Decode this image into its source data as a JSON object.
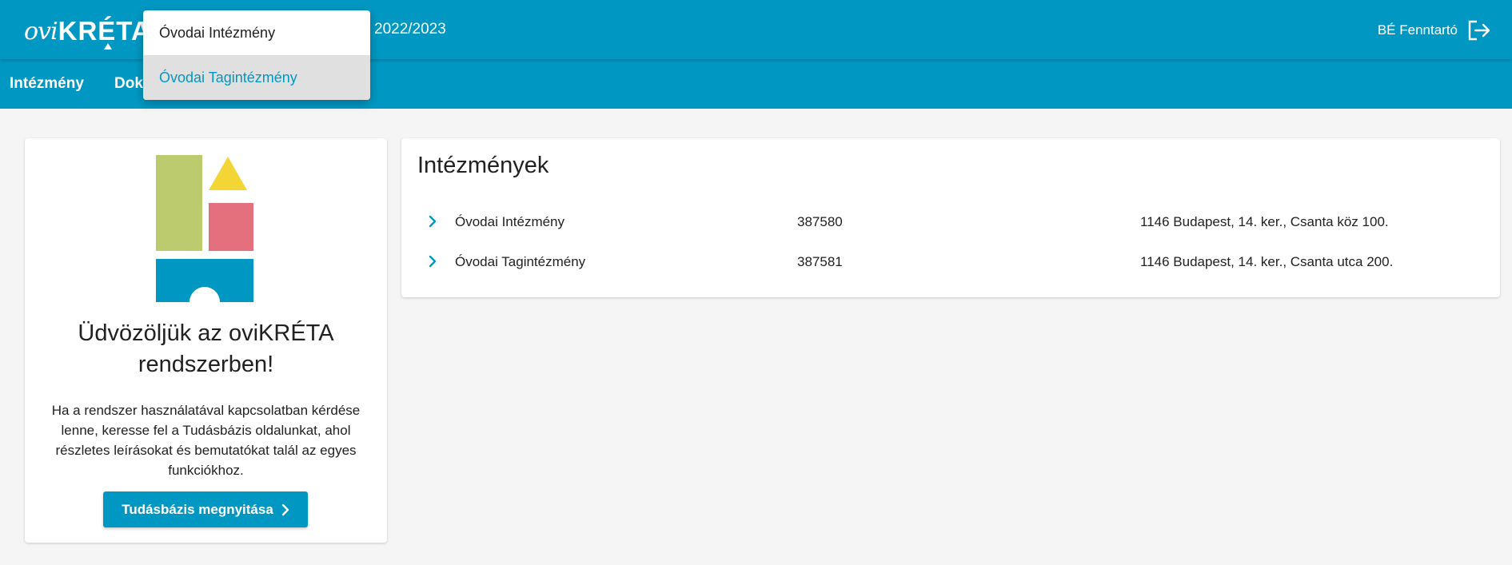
{
  "header": {
    "logo_ovi": "ovi",
    "logo_kreta": "KRÉTA",
    "school_year": "2022/2023",
    "user_name": "BÉ Fenntartó",
    "logout_icon": "logout-icon"
  },
  "nav": {
    "items": [
      {
        "label": "Intézmény"
      },
      {
        "label": "Dok"
      }
    ]
  },
  "dropdown": {
    "items": [
      {
        "label": "Óvodai Intézmény",
        "selected": false
      },
      {
        "label": "Óvodai Tagintézmény",
        "selected": true
      }
    ]
  },
  "welcome": {
    "title": "Üdvözöljük az oviKRÉTA rendszerben!",
    "text": "Ha a rendszer használatával kapcsolatban kérdése lenne, keresse fel a Tudásbázis oldalunkat, ahol részletes leírásokat és bemutatókat talál az egyes funkciókhoz.",
    "button_label": "Tudásbázis megnyitása"
  },
  "institutions": {
    "title": "Intézmények",
    "rows": [
      {
        "name": "Óvodai Intézmény",
        "code": "387580",
        "address": "1146 Budapest, 14. ker., Csanta köz 100."
      },
      {
        "name": "Óvodai Tagintézmény",
        "code": "387581",
        "address": "1146 Budapest, 14. ker., Csanta utca 200."
      }
    ]
  },
  "colors": {
    "primary": "#0098c3",
    "block_green": "#bccb6d",
    "block_yellow": "#f3d536",
    "block_pink": "#e5707d",
    "block_blue": "#0098c3"
  }
}
